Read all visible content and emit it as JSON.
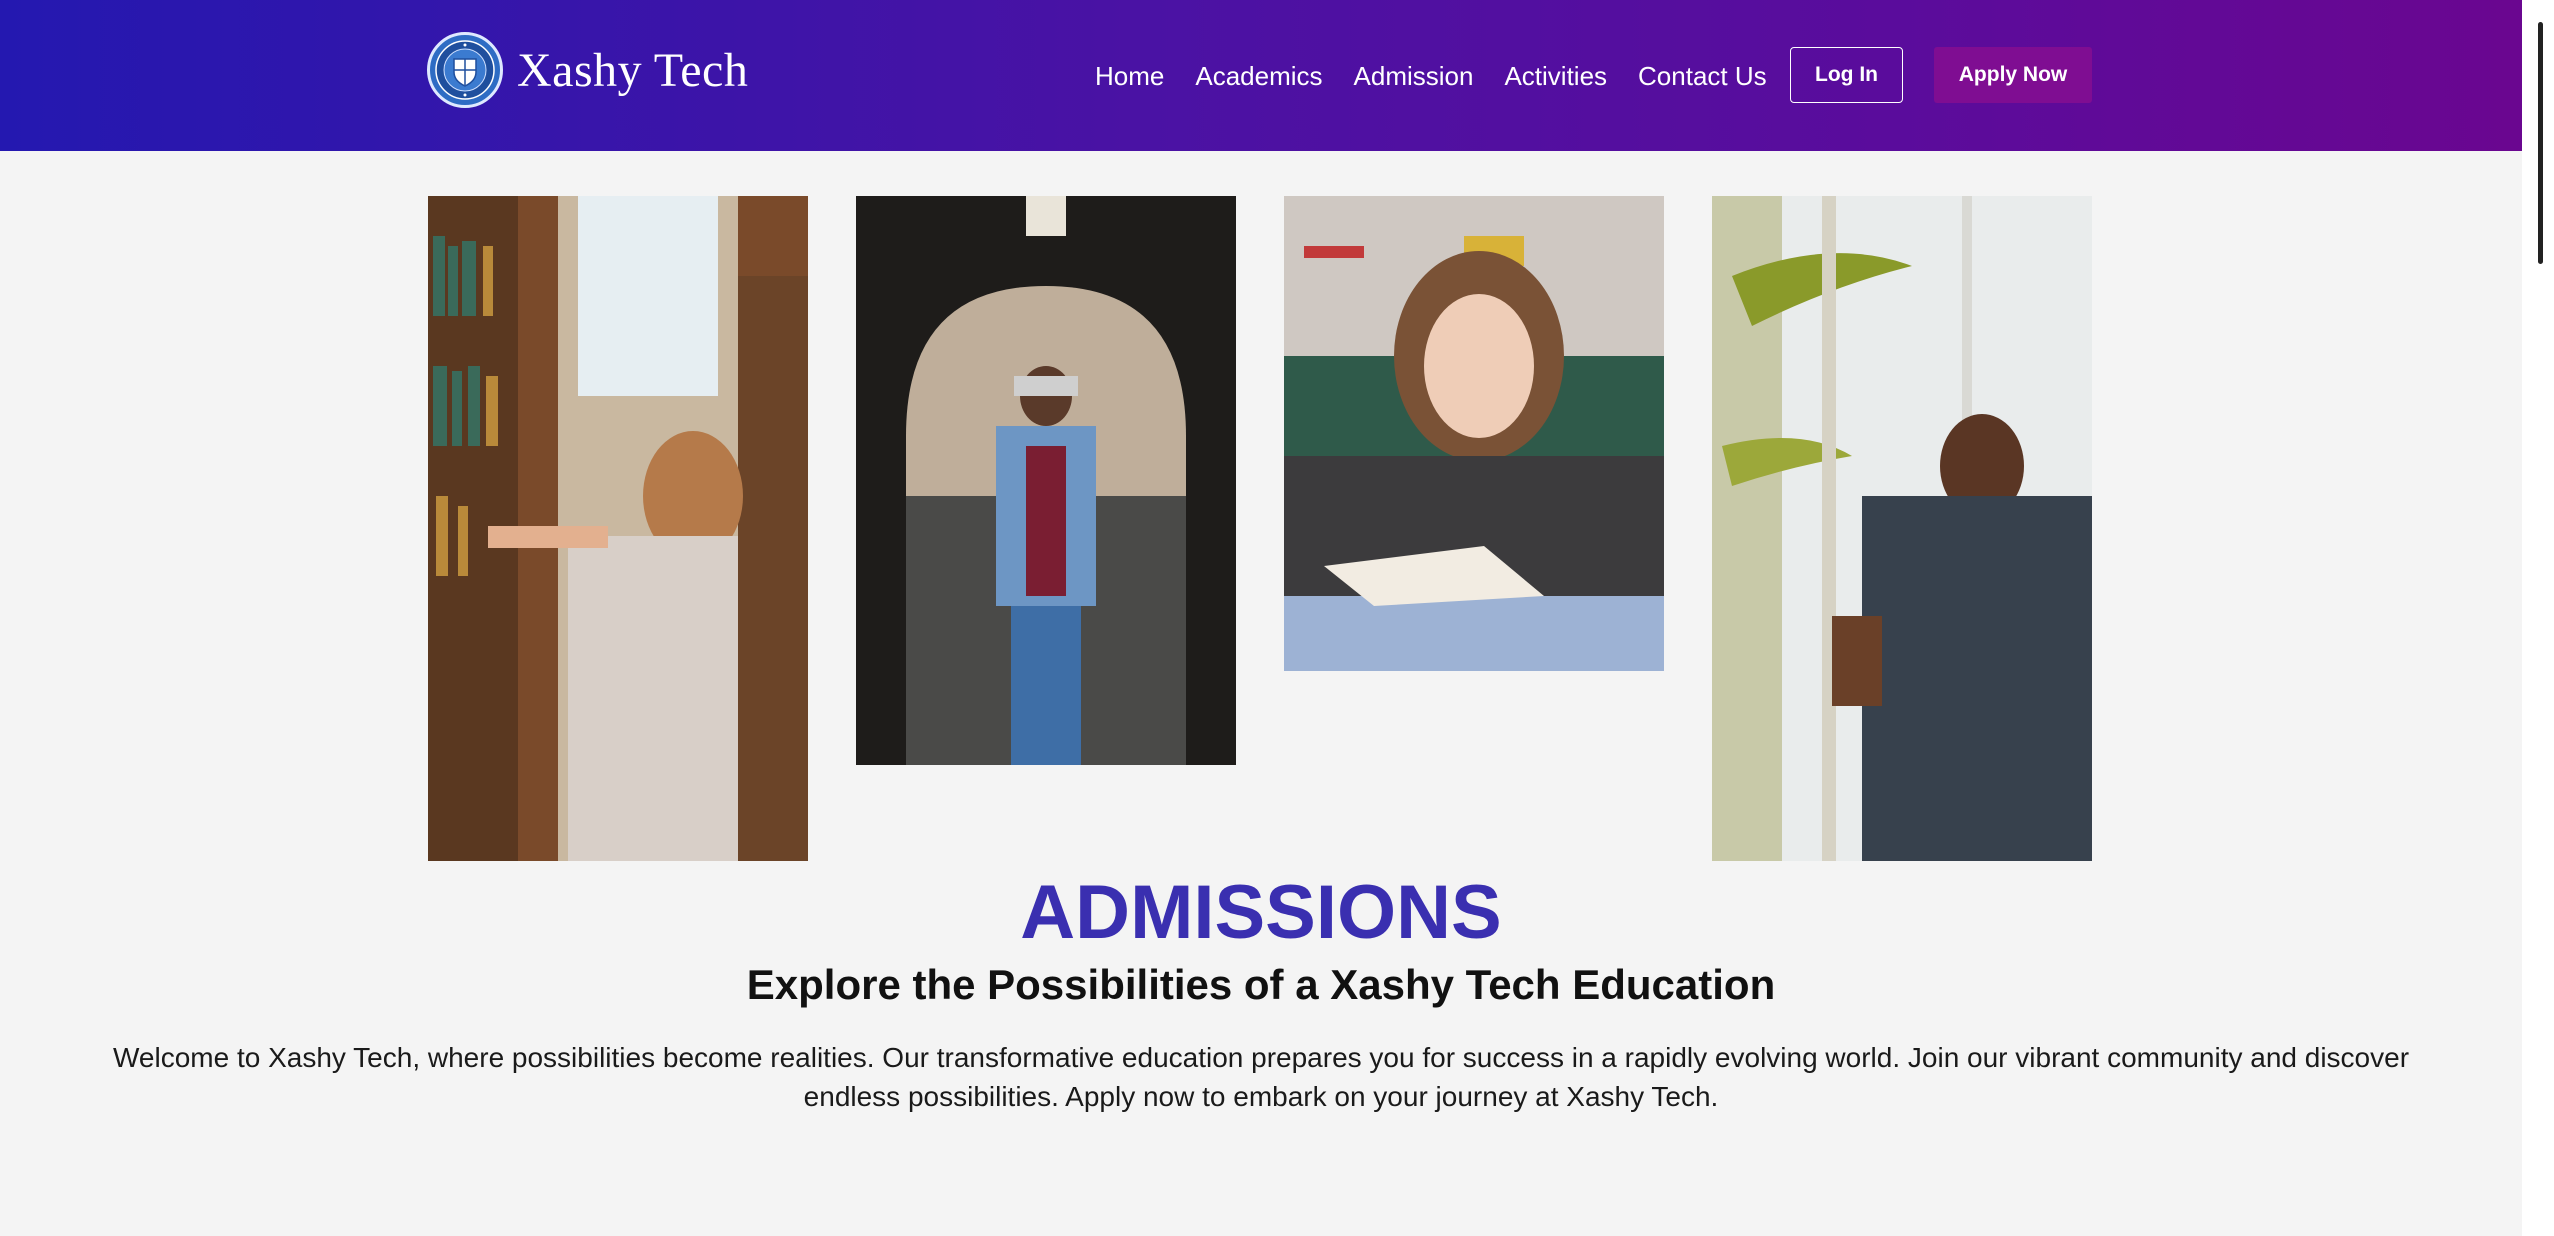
{
  "brand": {
    "name": "Xashy Tech",
    "crest_text": "XASHY TECH UNIVERSITY",
    "crest_monogram": "XTU"
  },
  "nav": {
    "items": [
      "Home",
      "Academics",
      "Admission",
      "Activities",
      "Contact Us"
    ]
  },
  "buttons": {
    "login": "Log In",
    "apply": "Apply Now"
  },
  "gallery": {
    "photos": [
      "student-in-library",
      "student-in-archway",
      "student-reading-at-desk",
      "student-by-window"
    ]
  },
  "hero": {
    "title": "ADMISSIONS",
    "subtitle": "Explore the Possibilities of a Xashy Tech Education",
    "intro": "Welcome to Xashy Tech, where possibilities become realities. Our transformative education prepares you for success in a rapidly evolving world. Join our vibrant community and discover endless possibilities. Apply now to embark on your journey at Xashy Tech."
  },
  "colors": {
    "header_start": "#2418b0",
    "header_end": "#6a0690",
    "apply_button": "#7f0d92",
    "title": "#3a2fb0",
    "page_background": "#f4f4f4"
  }
}
